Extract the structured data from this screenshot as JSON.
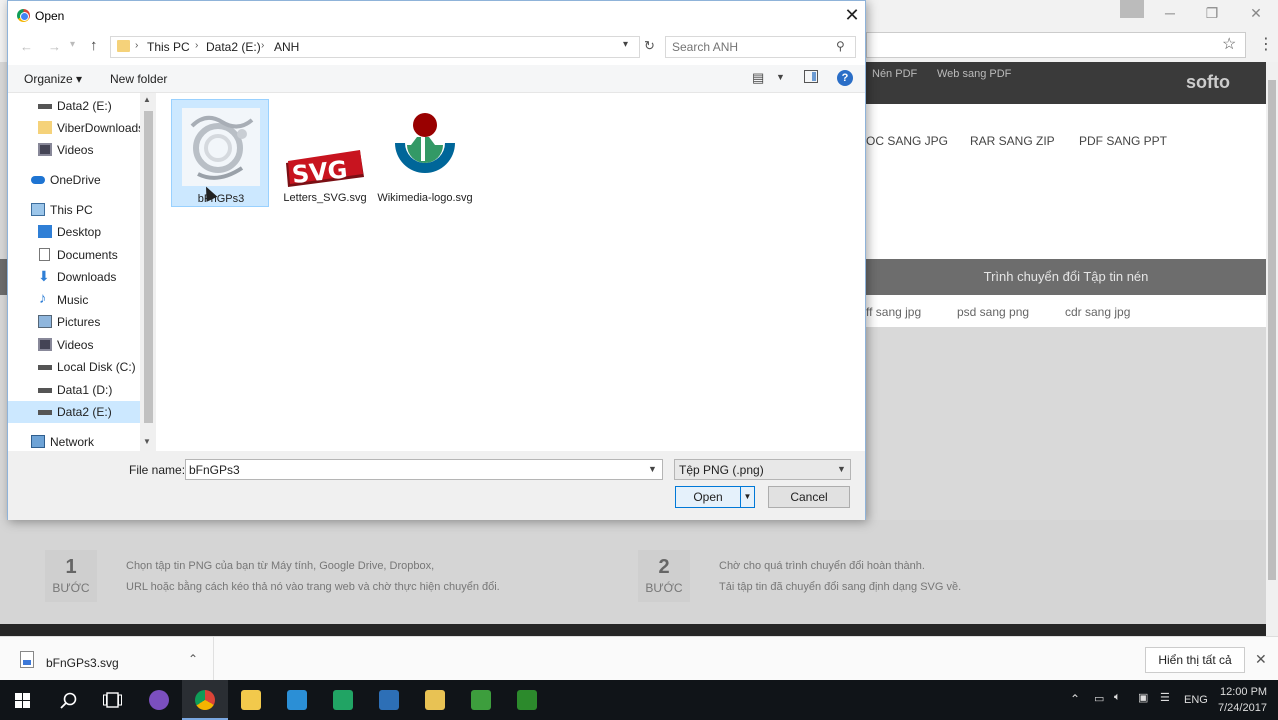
{
  "background_page": {
    "nav_links": [
      "Nén PDF",
      "Web sang PDF"
    ],
    "logo": "softo",
    "conversion_links": [
      "OC SANG JPG",
      "RAR SANG ZIP",
      "PDF SANG PPT"
    ],
    "section_title": "Trình chuyển đổi Tập tin nén",
    "sub_links": [
      "ff sang jpg",
      "psd sang png",
      "cdr sang jpg"
    ],
    "steps": [
      {
        "number": "1",
        "word": "BƯỚC",
        "line1": "Chọn tập tin PNG của bạn từ Máy tính, Google Drive, Dropbox,",
        "line2": "URL hoặc bằng cách kéo thả nó vào trang web và chờ thực hiện chuyển đổi."
      },
      {
        "number": "2",
        "word": "BƯỚC",
        "line1": "Chờ cho quá trình chuyển đổi hoàn thành.",
        "line2": "Tải tập tin đã chuyển đổi sang định dạng SVG về."
      }
    ]
  },
  "dialog": {
    "title": "Open",
    "breadcrumb": [
      "This PC",
      "Data2 (E:)",
      "ANH"
    ],
    "search_placeholder": "Search ANH",
    "toolbar": {
      "organize": "Organize ▾",
      "new_folder": "New folder"
    },
    "nav_items": [
      {
        "label": "Data2 (E:)",
        "icon": "drive-icon",
        "indent": 1
      },
      {
        "label": "ViberDownloads",
        "icon": "folder-icon",
        "indent": 1
      },
      {
        "label": "Videos",
        "icon": "videos-icon",
        "indent": 1
      },
      {
        "label": "OneDrive",
        "icon": "onedrive-icon",
        "indent": 0
      },
      {
        "label": "This PC",
        "icon": "computer-icon",
        "indent": 0
      },
      {
        "label": "Desktop",
        "icon": "desktop-icon",
        "indent": 1
      },
      {
        "label": "Documents",
        "icon": "documents-icon",
        "indent": 1
      },
      {
        "label": "Downloads",
        "icon": "downloads-icon",
        "indent": 1
      },
      {
        "label": "Music",
        "icon": "music-icon",
        "indent": 1
      },
      {
        "label": "Pictures",
        "icon": "pictures-icon",
        "indent": 1
      },
      {
        "label": "Videos",
        "icon": "videos-icon",
        "indent": 1
      },
      {
        "label": "Local Disk (C:)",
        "icon": "drive-icon",
        "indent": 1
      },
      {
        "label": "Data1 (D:)",
        "icon": "drive-icon",
        "indent": 1
      },
      {
        "label": "Data2 (E:)",
        "icon": "drive-icon",
        "indent": 1,
        "selected": true
      },
      {
        "label": "Network",
        "icon": "network-icon",
        "indent": 0
      }
    ],
    "files": [
      {
        "name": "bFnGPs3",
        "selected": true
      },
      {
        "name": "Letters_SVG.svg",
        "selected": false
      },
      {
        "name": "Wikimedia-logo.svg",
        "selected": false
      }
    ],
    "footer": {
      "file_name_label": "File name:",
      "file_name_value": "bFnGPs3",
      "file_type": "Tệp PNG (.png)",
      "open": "Open",
      "cancel": "Cancel"
    }
  },
  "download_bar": {
    "file": "bFnGPs3.svg",
    "show_all": "Hiển thị tất cả"
  },
  "tray": {
    "lang": "ENG",
    "time": "12:00 PM",
    "date": "7/24/2017"
  },
  "colors": {
    "selection": "#cce8ff",
    "accent": "#0078d7",
    "taskbar": "#101418"
  }
}
